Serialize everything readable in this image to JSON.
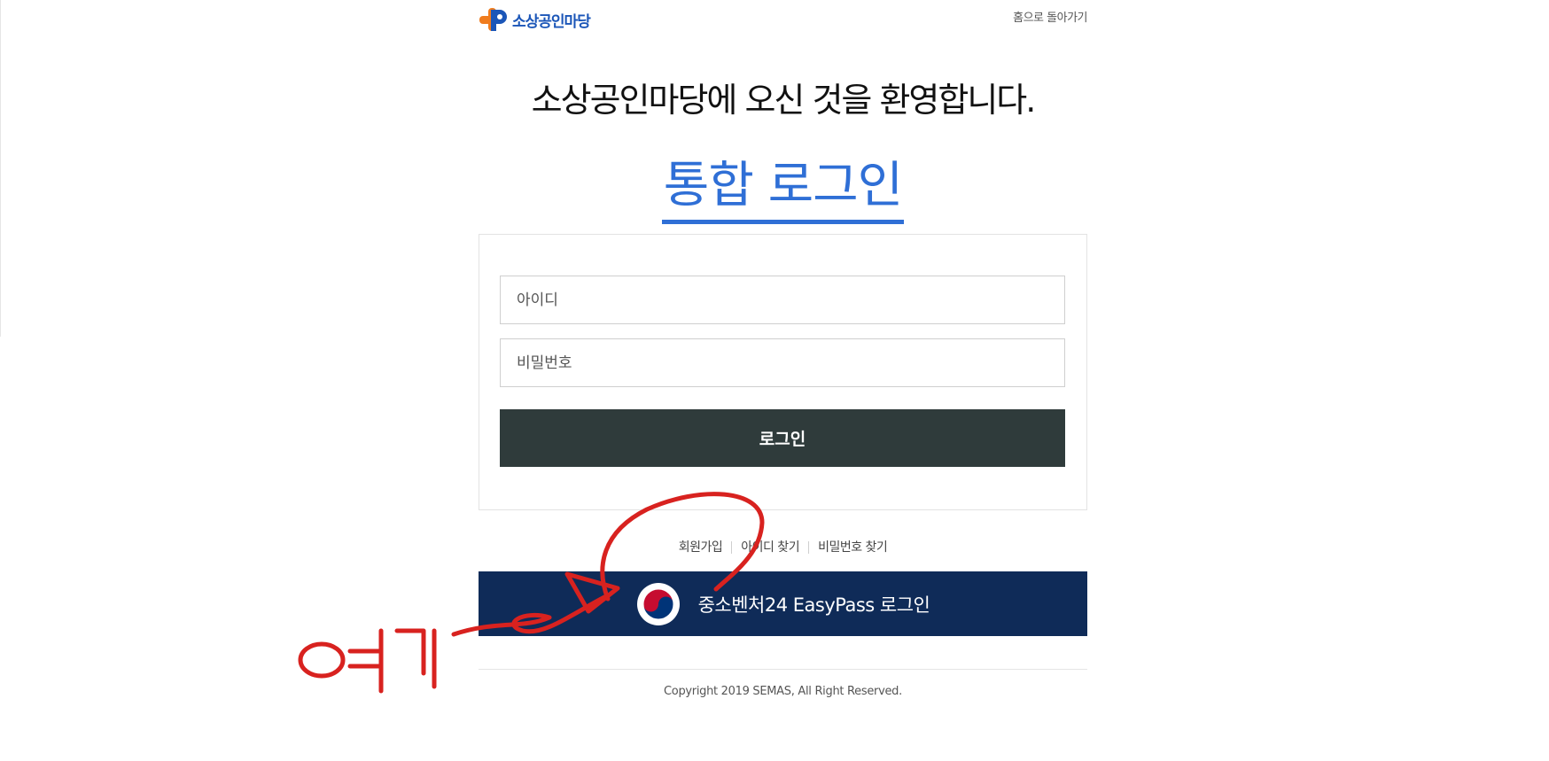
{
  "header": {
    "logo_text": "소상공인마당",
    "home_link": "홈으로 돌아가기"
  },
  "welcome": "소상공인마당에 오신 것을 환영합니다.",
  "login_title": "통합 로그인",
  "form": {
    "id_placeholder": "아이디",
    "password_placeholder": "비밀번호",
    "login_button": "로그인"
  },
  "links": {
    "signup": "회원가입",
    "find_id": "아이디 찾기",
    "find_password": "비밀번호 찾기"
  },
  "easypass": {
    "label": "중소벤처24 EasyPass 로그인",
    "icon": "taegeuk-icon"
  },
  "footer": {
    "copyright": "Copyright 2019 SEMAS, All Right Reserved."
  },
  "annotation": {
    "handwritten_text": "여기"
  },
  "colors": {
    "brand_blue": "#2f6fd6",
    "logo_blue": "#1b56b8",
    "logo_orange": "#f07c1e",
    "login_button": "#2f3b3b",
    "easypass_bg": "#0f2b58",
    "annotation_red": "#d8221f"
  }
}
